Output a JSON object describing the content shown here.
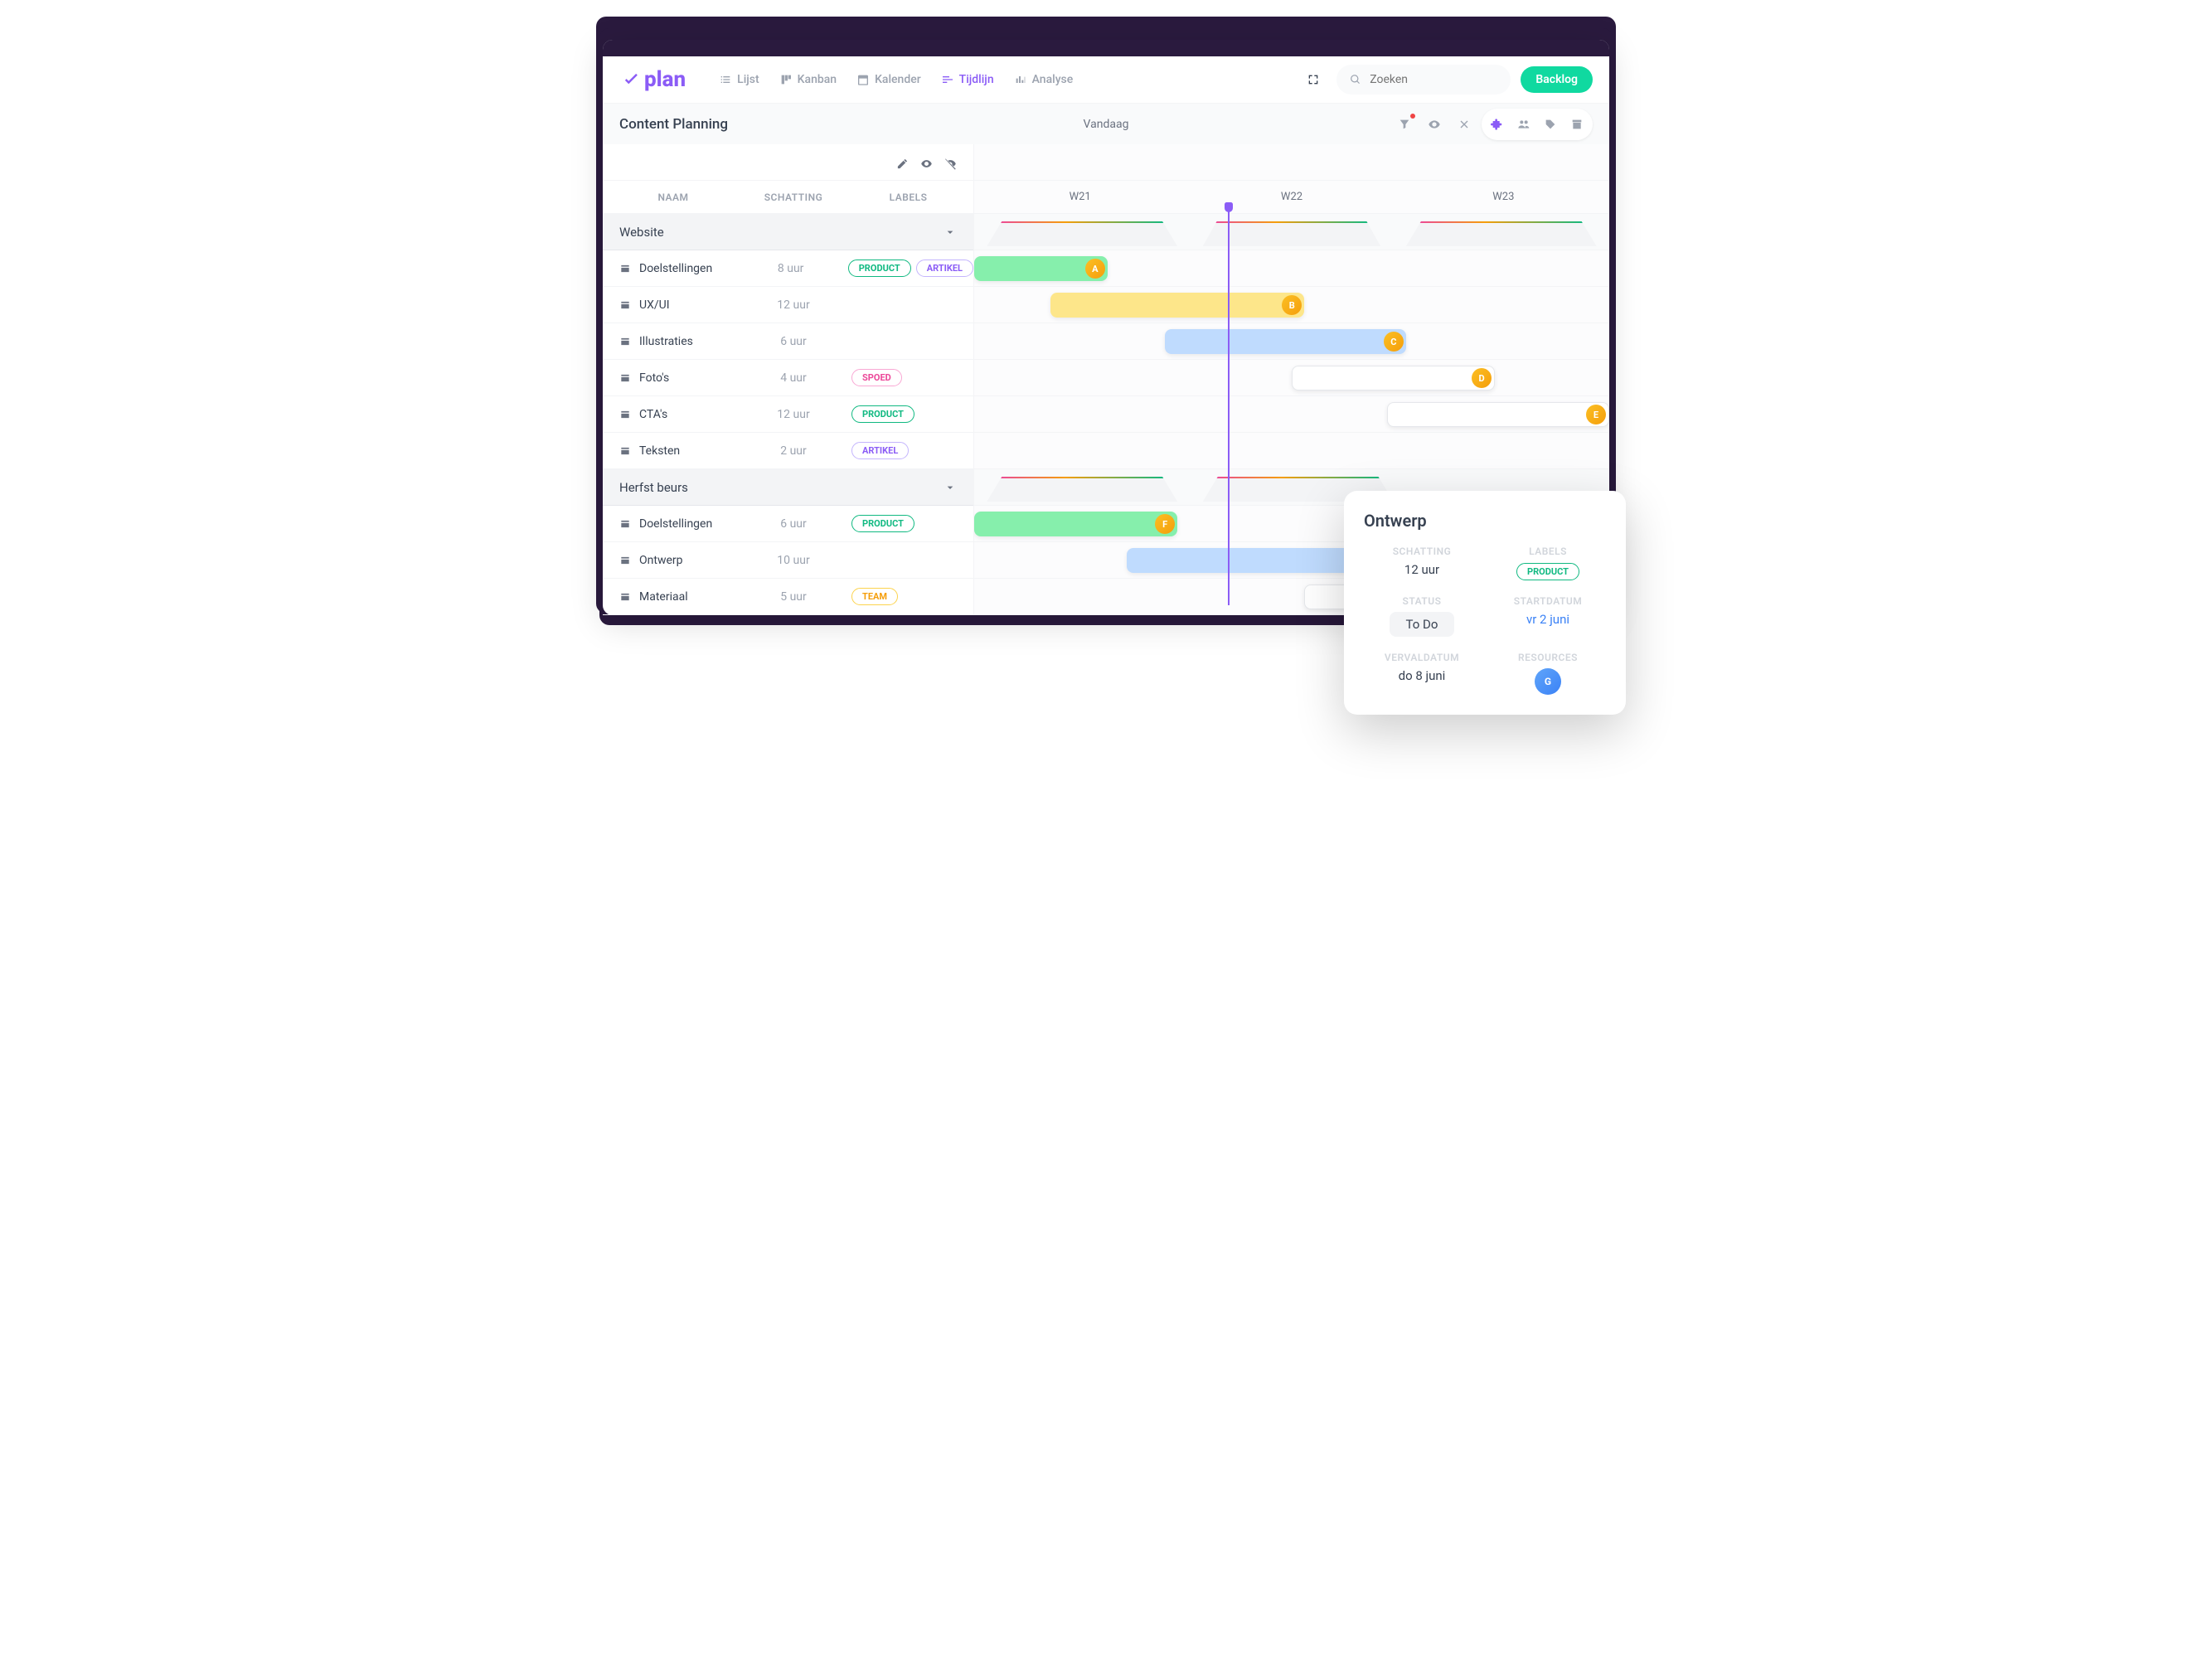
{
  "app": {
    "name": "plan"
  },
  "nav": {
    "lijst": "Lijst",
    "kanban": "Kanban",
    "kalender": "Kalender",
    "tijdlijn": "Tijdlijn",
    "analyse": "Analyse"
  },
  "search": {
    "placeholder": "Zoeken"
  },
  "backlog_btn": "Backlog",
  "page_title": "Content Planning",
  "today_label": "Vandaag",
  "columns": {
    "naam": "NAAM",
    "schatting": "SCHATTING",
    "labels": "LABELS"
  },
  "weeks": [
    "W21",
    "W22",
    "W23"
  ],
  "labels": {
    "product": "PRODUCT",
    "artikel": "ARTIKEL",
    "spoed": "SPOED",
    "team": "TEAM"
  },
  "groups": [
    {
      "name": "Website",
      "tasks": [
        {
          "name": "Doelstellingen",
          "estimate": "8 uur",
          "labels": [
            "product",
            "artikel"
          ]
        },
        {
          "name": "UX/UI",
          "estimate": "12 uur",
          "labels": []
        },
        {
          "name": "Illustraties",
          "estimate": "6 uur",
          "labels": []
        },
        {
          "name": "Foto's",
          "estimate": "4 uur",
          "labels": [
            "spoed"
          ]
        },
        {
          "name": "CTA's",
          "estimate": "12 uur",
          "labels": [
            "product"
          ]
        },
        {
          "name": "Teksten",
          "estimate": "2 uur",
          "labels": [
            "artikel"
          ]
        }
      ]
    },
    {
      "name": "Herfst beurs",
      "tasks": [
        {
          "name": "Doelstellingen",
          "estimate": "6 uur",
          "labels": [
            "product"
          ]
        },
        {
          "name": "Ontwerp",
          "estimate": "10 uur",
          "labels": []
        },
        {
          "name": "Materiaal",
          "estimate": "5 uur",
          "labels": [
            "team"
          ]
        }
      ]
    }
  ],
  "popover": {
    "title": "Ontwerp",
    "schatting_label": "SCHATTING",
    "schatting_value": "12 uur",
    "labels_label": "LABELS",
    "labels_value": "PRODUCT",
    "status_label": "STATUS",
    "status_value": "To Do",
    "startdatum_label": "STARTDATUM",
    "startdatum_value": "vr 2 juni",
    "vervaldatum_label": "VERVALDATUM",
    "vervaldatum_value": "do 8 juni",
    "resources_label": "RESOURCES"
  }
}
